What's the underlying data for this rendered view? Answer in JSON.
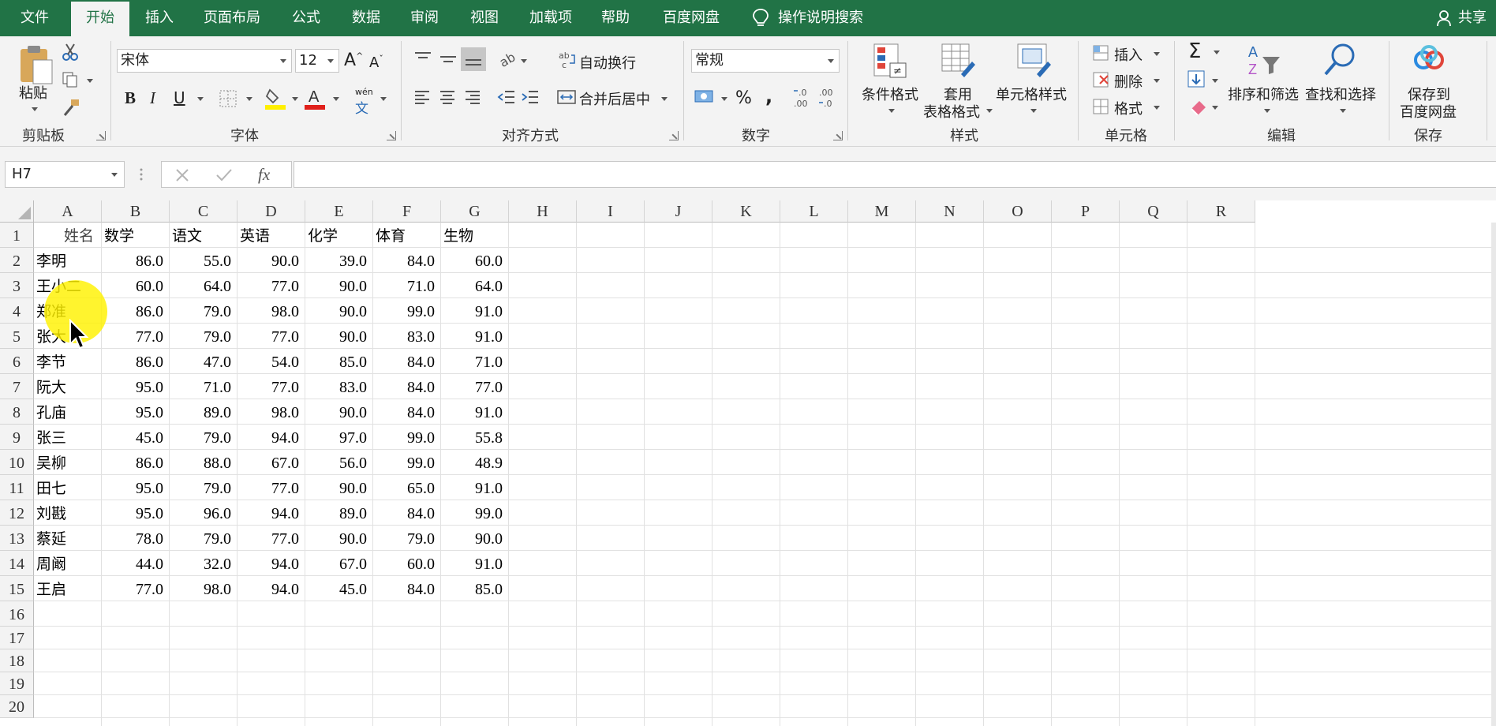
{
  "tabs": [
    "文件",
    "开始",
    "插入",
    "页面布局",
    "公式",
    "数据",
    "审阅",
    "视图",
    "加载项",
    "帮助",
    "百度网盘"
  ],
  "active_tab": "开始",
  "tell_me": "操作说明搜索",
  "share": "共享",
  "ribbon": {
    "clipboard": {
      "title": "剪贴板",
      "paste": "粘贴"
    },
    "font": {
      "title": "字体",
      "font_name": "宋体",
      "font_size": "12",
      "bold": "B",
      "italic": "I",
      "underline": "U",
      "phonetic": "wén"
    },
    "alignment": {
      "title": "对齐方式",
      "wrap_text": "自动换行",
      "merge_center": "合并后居中"
    },
    "number": {
      "title": "数字",
      "format": "常规",
      "percent": "%",
      "comma": ","
    },
    "styles": {
      "title": "样式",
      "conditional": "条件格式",
      "table_line1": "套用",
      "table_line2": "表格格式",
      "cell_styles": "单元格样式"
    },
    "cells": {
      "title": "单元格",
      "insert": "插入",
      "delete": "删除",
      "format": "格式"
    },
    "editing": {
      "title": "编辑",
      "sum": "Σ",
      "sort_filter": "排序和筛选",
      "find_select": "查找和选择"
    },
    "save": {
      "title": "保存",
      "line1": "保存到",
      "line2": "百度网盘"
    }
  },
  "formula_bar": {
    "name_box": "H7",
    "fx": "fx",
    "formula": ""
  },
  "columns": [
    "A",
    "B",
    "C",
    "D",
    "E",
    "F",
    "G",
    "H",
    "I",
    "J",
    "K",
    "L",
    "M",
    "N",
    "O",
    "P",
    "Q",
    "R"
  ],
  "row_numbers": [
    "1",
    "2",
    "3",
    "4",
    "5",
    "6",
    "7",
    "8",
    "9",
    "10",
    "11",
    "12",
    "13",
    "14",
    "15",
    "16",
    "17",
    "18",
    "19",
    "20"
  ],
  "sheet": {
    "header": [
      "姓名",
      "数学",
      "语文",
      "英语",
      "化学",
      "体育",
      "生物"
    ],
    "rows": [
      [
        "李明",
        "86.0",
        "55.0",
        "90.0",
        "39.0",
        "84.0",
        "60.0"
      ],
      [
        "王小二",
        "60.0",
        "64.0",
        "77.0",
        "90.0",
        "71.0",
        "64.0"
      ],
      [
        "郑准",
        "86.0",
        "79.0",
        "98.0",
        "90.0",
        "99.0",
        "91.0"
      ],
      [
        "张大",
        "77.0",
        "79.0",
        "77.0",
        "90.0",
        "83.0",
        "91.0"
      ],
      [
        "李节",
        "86.0",
        "47.0",
        "54.0",
        "85.0",
        "84.0",
        "71.0"
      ],
      [
        "阮大",
        "95.0",
        "71.0",
        "77.0",
        "83.0",
        "84.0",
        "77.0"
      ],
      [
        "孔庙",
        "95.0",
        "89.0",
        "98.0",
        "90.0",
        "84.0",
        "91.0"
      ],
      [
        "张三",
        "45.0",
        "79.0",
        "94.0",
        "97.0",
        "99.0",
        "55.8"
      ],
      [
        "吴柳",
        "86.0",
        "88.0",
        "67.0",
        "56.0",
        "99.0",
        "48.9"
      ],
      [
        "田七",
        "95.0",
        "79.0",
        "77.0",
        "90.0",
        "65.0",
        "91.0"
      ],
      [
        "刘戡",
        "95.0",
        "96.0",
        "94.0",
        "89.0",
        "84.0",
        "99.0"
      ],
      [
        "蔡延",
        "78.0",
        "79.0",
        "77.0",
        "90.0",
        "79.0",
        "90.0"
      ],
      [
        "周阚",
        "44.0",
        "32.0",
        "94.0",
        "67.0",
        "60.0",
        "91.0"
      ],
      [
        "王启",
        "77.0",
        "98.0",
        "94.0",
        "45.0",
        "84.0",
        "85.0"
      ]
    ]
  }
}
